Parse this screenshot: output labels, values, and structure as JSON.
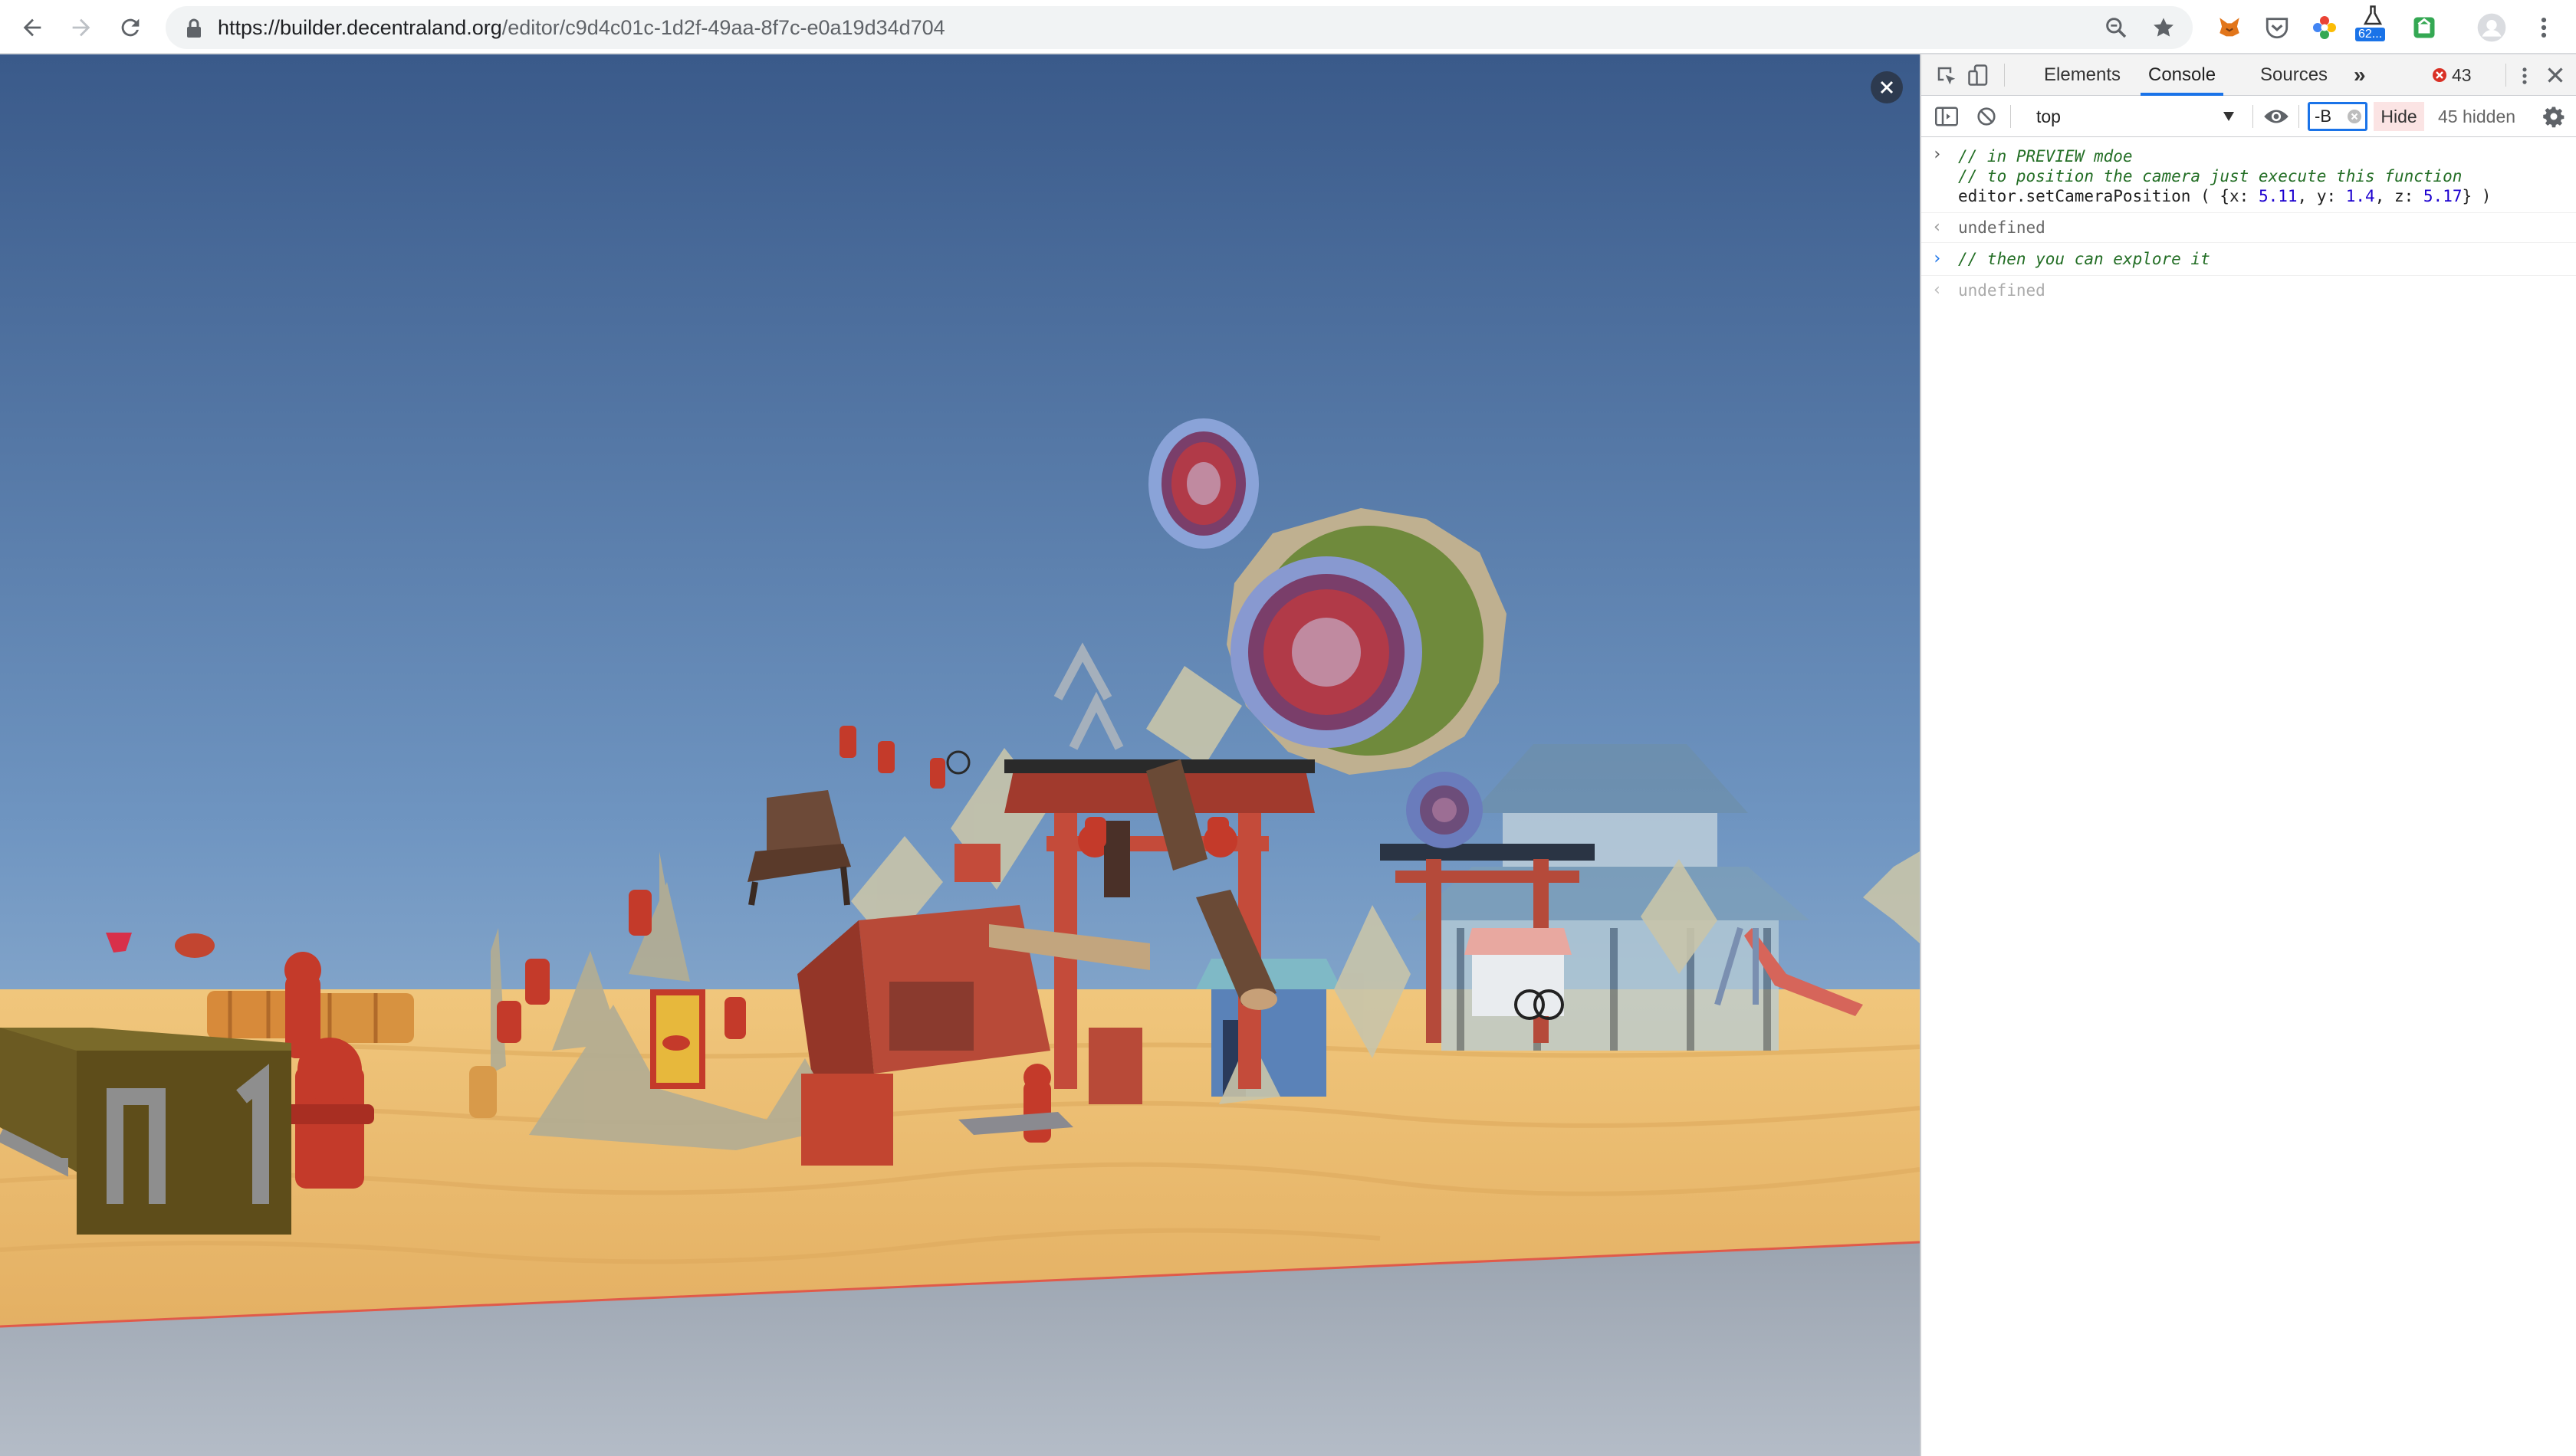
{
  "browser": {
    "url_host": "https://builder.decentraland.org",
    "url_path": "/editor/c9d4c01c-1d2f-49aa-8f7c-e0a19d34d704",
    "ext_badge": "62..."
  },
  "devtools": {
    "tabs": [
      "Elements",
      "Console",
      "Sources"
    ],
    "active_tab": "Console",
    "error_count": "43",
    "context": "top",
    "filter_value": "-B",
    "hide_label": "Hide",
    "hidden_count": "45 hidden"
  },
  "console": {
    "entry1": {
      "line1": "// in PREVIEW mdoe",
      "line2": "// to position the camera just execute this function",
      "call": "editor.setCameraPosition",
      "args_open": " ( {x: ",
      "x": "5.11",
      "y_label": ", y: ",
      "y": "1.4",
      "z_label": ", z: ",
      "z": "5.17",
      "args_close": "} )"
    },
    "result1": "undefined",
    "entry2": "// then you can explore it",
    "result2": "undefined"
  },
  "colors": {
    "accent": "#1a73e8",
    "error": "#d93025",
    "sky_top": "#3a5a8a",
    "sand": "#e9bb6e"
  }
}
